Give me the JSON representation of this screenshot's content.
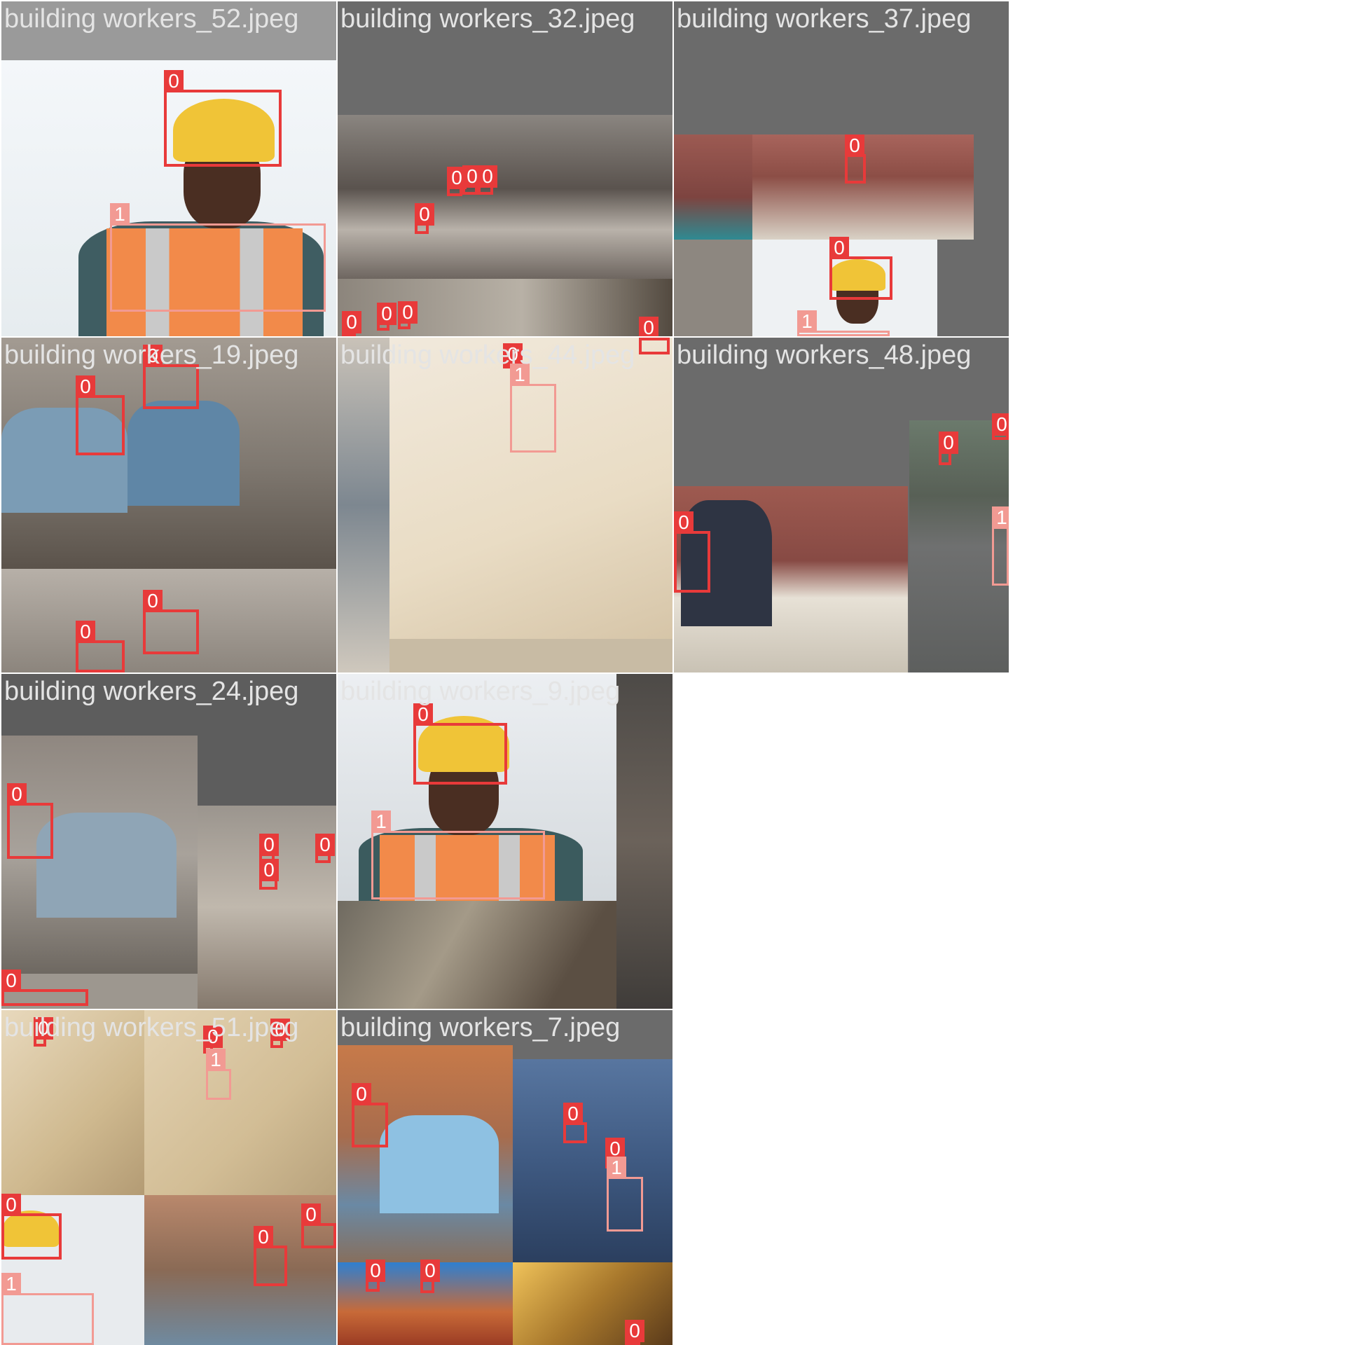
{
  "tiles": [
    {
      "caption": "building workers_52.jpeg",
      "labels": [
        "0",
        "1"
      ]
    },
    {
      "caption": "building workers_32.jpeg",
      "labels": [
        "0",
        "0",
        "0",
        "0",
        "0",
        "0",
        "0",
        "0"
      ]
    },
    {
      "caption": "building workers_37.jpeg",
      "labels": [
        "0",
        "0",
        "1"
      ]
    },
    {
      "caption": "building workers_19.jpeg",
      "labels": [
        "0",
        "0",
        "0",
        "0"
      ]
    },
    {
      "caption": "building workers_44.jpeg",
      "labels": [
        "0",
        "1",
        "0"
      ]
    },
    {
      "caption": "building workers_48.jpeg",
      "labels": [
        "0",
        "0",
        "1",
        "0"
      ]
    },
    {
      "caption": "building workers_24.jpeg",
      "labels": [
        "0",
        "0",
        "0",
        "0",
        "0"
      ]
    },
    {
      "caption": "building workers_9.jpeg",
      "labels": [
        "0",
        "1"
      ]
    },
    {
      "caption": "building workers_51.jpeg",
      "labels": [
        "0",
        "0",
        "1",
        "0",
        "0",
        "1",
        "0",
        "0"
      ]
    },
    {
      "caption": "building workers_7.jpeg",
      "labels": [
        "0",
        "0",
        "0",
        "1",
        "0",
        "0",
        "0"
      ]
    }
  ],
  "colors": {
    "class0": "#e83a3a",
    "class1": "#f29a93",
    "tile_bg": "#6b6b6b"
  }
}
